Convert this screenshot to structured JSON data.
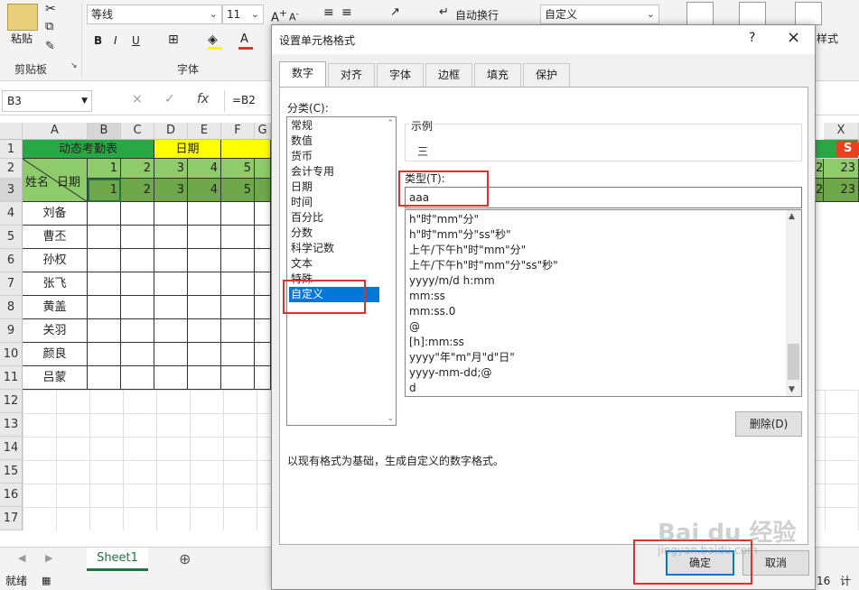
{
  "ribbon": {
    "paste_label": "粘贴",
    "clipboard_label": "剪贴板",
    "font_name": "等线",
    "font_size": "11",
    "bold": "B",
    "italic": "I",
    "underline": "U",
    "font_group_label": "字体",
    "wrap_text": "自动换行",
    "number_format": "自定义",
    "styles_partial": "样式"
  },
  "formula_bar": {
    "name_box": "B3",
    "cancel": "×",
    "enter": "✓",
    "fx": "fx",
    "formula": "=B2"
  },
  "grid": {
    "columns": [
      "A",
      "B",
      "C",
      "D",
      "E",
      "F",
      "G",
      "X"
    ],
    "rows": [
      "1",
      "2",
      "3",
      "4",
      "5",
      "6",
      "7",
      "8",
      "9",
      "10",
      "11",
      "12",
      "13",
      "14",
      "15",
      "16",
      "17"
    ],
    "title": "动态考勤表",
    "date_header": "日期",
    "corner_name": "姓名",
    "corner_date": "日期",
    "row2": [
      "1",
      "2",
      "3",
      "4",
      "5"
    ],
    "row3": [
      "1",
      "2",
      "3",
      "4",
      "5"
    ],
    "right_row2": [
      "2",
      "23"
    ],
    "right_row3": [
      "2",
      "23"
    ],
    "names": [
      "刘备",
      "曹丕",
      "孙权",
      "张飞",
      "黄盖",
      "关羽",
      "颜良",
      "吕蒙"
    ]
  },
  "sheet_tab": "Sheet1",
  "status": {
    "ready": "就绪",
    "count_fragment": "计数",
    "value_fragment": "16"
  },
  "dialog": {
    "title": "设置单元格格式",
    "help": "?",
    "close": "×",
    "tabs": [
      "数字",
      "对齐",
      "字体",
      "边框",
      "填充",
      "保护"
    ],
    "category_label": "分类(C):",
    "categories": [
      "常规",
      "数值",
      "货币",
      "会计专用",
      "日期",
      "时间",
      "百分比",
      "分数",
      "科学记数",
      "文本",
      "特殊",
      "自定义"
    ],
    "sample_label": "示例",
    "sample_value": "三",
    "type_label": "类型(T):",
    "type_value": "aaa",
    "formats": [
      "h\"时\"mm\"分\"",
      "h\"时\"mm\"分\"ss\"秒\"",
      "上午/下午h\"时\"mm\"分\"",
      "上午/下午h\"时\"mm\"分\"ss\"秒\"",
      "yyyy/m/d h:mm",
      "mm:ss",
      "mm:ss.0",
      "@",
      "[h]:mm:ss",
      "yyyy\"年\"m\"月\"d\"日\"",
      "yyyy-mm-dd;@",
      "d"
    ],
    "delete_btn": "删除(D)",
    "description": "以现有格式为基础，生成自定义的数字格式。",
    "ok_btn": "确定",
    "cancel_btn": "取消"
  },
  "watermark": {
    "brand": "Bai du 经验",
    "url": "jingyan.baidu.com"
  },
  "colors": {
    "green_header": "#2aa745",
    "yellow_header": "#ffff00",
    "light_green": "#8ecb6b",
    "dark_green": "#6fa84a",
    "selection_blue": "#0078d7",
    "highlight_red": "#e0302b"
  }
}
